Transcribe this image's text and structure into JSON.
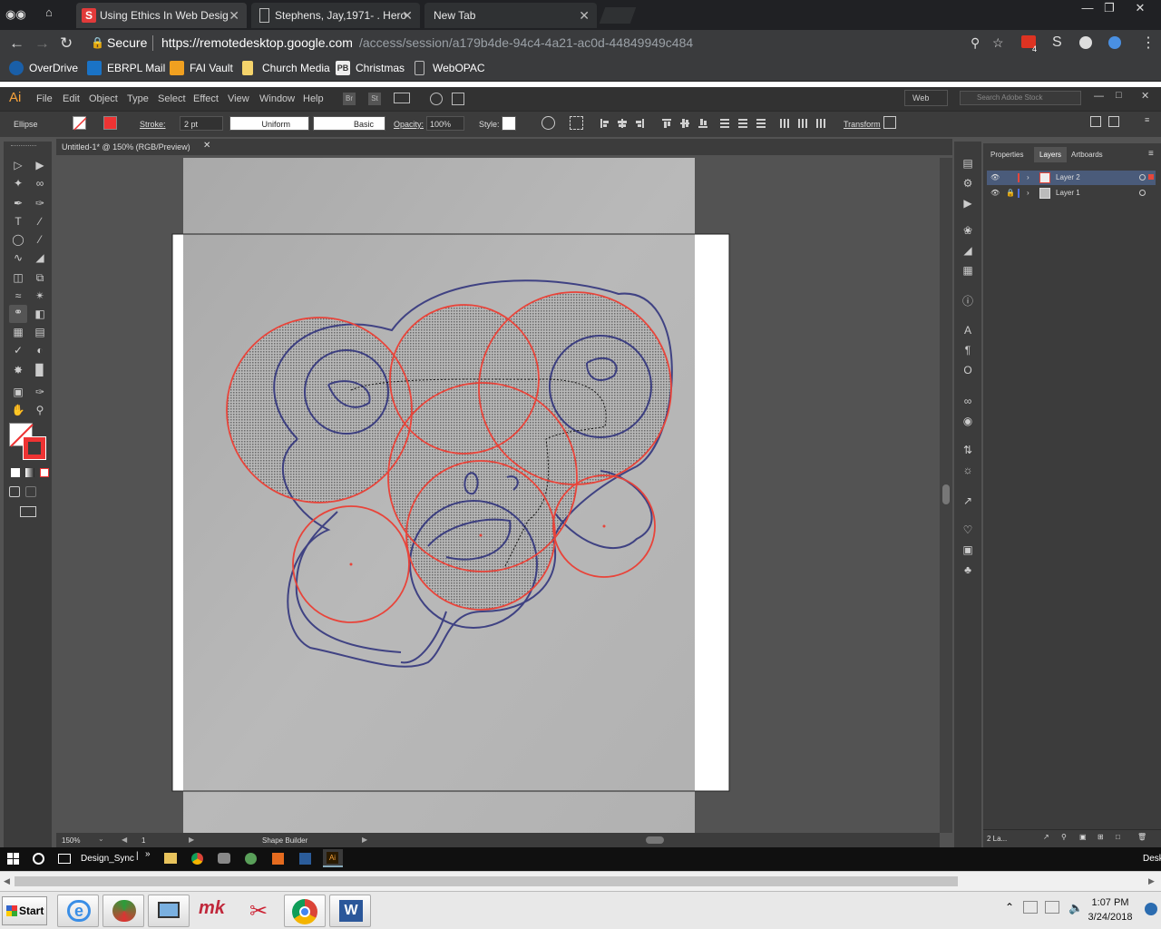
{
  "browser": {
    "tabs": [
      {
        "title": "Using Ethics In Web Desig",
        "icon": "scribd-icon",
        "active": true
      },
      {
        "title": "Stephens, Jay,1971- . Hero",
        "icon": "document-icon",
        "active": false
      },
      {
        "title": "New Tab",
        "icon": "",
        "active": false
      }
    ],
    "secure_label": "Secure",
    "url_host": "https://remotedesktop.google.com",
    "url_path": "/access/session/a179b4de-94c4-4a21-ac0d-44849949c484",
    "extension_badge": "4",
    "bookmarks": [
      {
        "label": "OverDrive",
        "icon": "overdrive-icon"
      },
      {
        "label": "EBRPL Mail",
        "icon": "outlook-icon"
      },
      {
        "label": "FAI Vault",
        "icon": "vault-icon"
      },
      {
        "label": "Church Media",
        "icon": "folder-icon"
      },
      {
        "label": "Christmas",
        "icon": "pb-icon"
      },
      {
        "label": "WebOPAC",
        "icon": "page-icon"
      }
    ]
  },
  "illustrator": {
    "logo": "Ai",
    "menus": [
      "File",
      "Edit",
      "Object",
      "Type",
      "Select",
      "Effect",
      "View",
      "Window",
      "Help"
    ],
    "bridge_label": "Br",
    "stock_label": "St",
    "workspace": "Web",
    "stock_search_placeholder": "Search Adobe Stock",
    "control": {
      "selection_type": "Ellipse",
      "stroke_label": "Stroke:",
      "stroke_value": "2 pt",
      "profile": "Uniform",
      "brush": "Basic",
      "opacity_label": "Opacity:",
      "opacity_value": "100%",
      "style_label": "Style:",
      "transform_label": "Transform"
    },
    "doc_tab": "Untitled-1* @ 150% (RGB/Preview)",
    "status": {
      "zoom": "150%",
      "artboard": "1",
      "tool": "Shape Builder"
    },
    "panel": {
      "tabs": [
        "Properties",
        "Layers",
        "Artboards"
      ],
      "active_tab": "Layers",
      "layers": [
        {
          "name": "Layer 2",
          "color": "#e5473b",
          "locked": false,
          "selected": true
        },
        {
          "name": "Layer 1",
          "color": "#4b6fe0",
          "locked": true,
          "selected": false
        }
      ],
      "footer_count": "2 La..."
    }
  },
  "remote_taskbar": {
    "items": [
      {
        "label": "Design_Sync",
        "icon": "folder-icon"
      }
    ],
    "tray_text": "Desk"
  },
  "local_taskbar": {
    "start_label": "Start",
    "clock_time": "1:07 PM",
    "clock_date": "3/24/2018",
    "apps": [
      "ie-icon",
      "network-icon",
      "remote-icon",
      "mk-icon",
      "scissors-icon",
      "chrome-icon",
      "word-icon"
    ]
  },
  "colors": {
    "chrome_dark": "#202124",
    "ai_ui": "#3c3c3c",
    "ai_canvas": "#535353",
    "circle_stroke": "#e8443a",
    "sketch_ink": "#2b2e7a"
  }
}
